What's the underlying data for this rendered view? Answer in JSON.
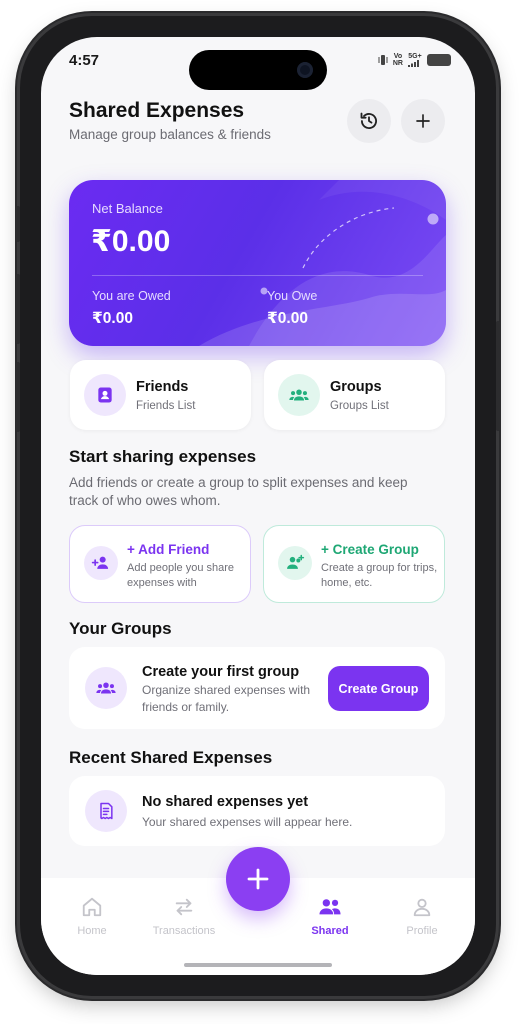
{
  "status_bar": {
    "time": "4:57",
    "volte": "Vo\nNR",
    "network": "5G+"
  },
  "header": {
    "title": "Shared Expenses",
    "subtitle": "Manage group balances & friends",
    "history_icon": "history-icon",
    "add_icon": "plus-icon"
  },
  "balance": {
    "net_label": "Net Balance",
    "net_value": "₹0.00",
    "owed_label": "You are Owed",
    "owed_value": "₹0.00",
    "owe_label": "You Owe",
    "owe_value": "₹0.00"
  },
  "tiles": [
    {
      "title": "Friends",
      "subtitle": "Friends List",
      "icon": "contact-icon"
    },
    {
      "title": "Groups",
      "subtitle": "Groups List",
      "icon": "group-icon"
    }
  ],
  "start_section": {
    "title": "Start sharing expenses",
    "description": "Add friends or create a group to split expenses and keep track of who owes whom."
  },
  "actions": [
    {
      "title": "+ Add Friend",
      "subtitle": "Add people you share expenses with",
      "icon": "add-person-icon"
    },
    {
      "title": "+ Create Group",
      "subtitle": "Create a group for trips, home, etc.",
      "icon": "add-group-icon"
    }
  ],
  "groups_section": {
    "title": "Your Groups",
    "card_title": "Create your first group",
    "card_subtitle": "Organize shared expenses with friends or family.",
    "button_label": "Create Group"
  },
  "recent_section": {
    "title": "Recent Shared Expenses",
    "card_title": "No shared expenses yet",
    "card_subtitle": "Your shared expenses will appear here."
  },
  "tab_bar": {
    "items": [
      {
        "label": "Home",
        "icon": "home-icon"
      },
      {
        "label": "Transactions",
        "icon": "swap-icon"
      },
      {
        "label": "Shared",
        "icon": "people-icon"
      },
      {
        "label": "Profile",
        "icon": "profile-icon"
      }
    ],
    "active": "Shared"
  },
  "colors": {
    "accent": "#7b34f0",
    "green": "#22b07d",
    "card_start": "#6b2bf2",
    "card_end": "#7a4cf4"
  }
}
